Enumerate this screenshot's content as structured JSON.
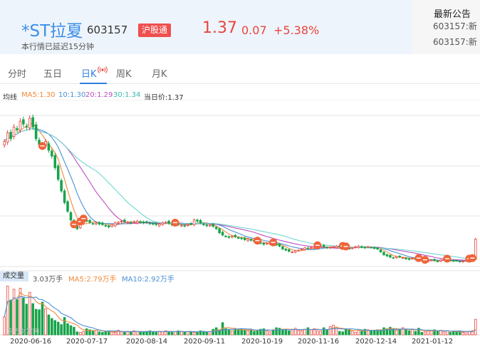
{
  "header": {
    "stock_name": "*ST拉夏",
    "stock_code": "603157",
    "badge": "沪股通",
    "price": "1.37",
    "change": "0.07",
    "change_pct": "+5.38%",
    "delay_note": "本行情已延迟15分钟"
  },
  "news": {
    "title": "最新公告",
    "items": [
      "603157:新",
      "603157:新"
    ]
  },
  "tabs": [
    {
      "label": "分时"
    },
    {
      "label": "五日"
    },
    {
      "label": "日K"
    },
    {
      "label": "周K"
    },
    {
      "label": "月K"
    }
  ],
  "legend": {
    "label": "均线",
    "ma5": "MA5:1.30",
    "ma10": "10:1.30",
    "ma20": "20:1.29",
    "ma30": "30:1.34",
    "current": "当日价:1.37"
  },
  "volume": {
    "title": "成交量",
    "value": "3.03万手",
    "ma5": "MA5:2.79万手",
    "ma10": "MA10:2.92万手"
  },
  "watermark": "东方财富网",
  "chart_data": {
    "type": "candlestick",
    "x_ticks": [
      "2020-06-16",
      "2020-07-17",
      "2020-08-14",
      "2020-09-11",
      "2020-10-19",
      "2020-11-16",
      "2020-12-14",
      "2021-01-12"
    ],
    "grid": true,
    "colors": {
      "up": "#e8453c",
      "down": "#19a34a",
      "ma5": "#f08a3c",
      "ma10": "#4a90d6",
      "ma20": "#c04fc0",
      "ma30": "#6fd6d0",
      "marker": "#f0643a"
    },
    "close": [
      3.05,
      3.2,
      3.1,
      3.3,
      3.25,
      3.4,
      3.35,
      3.3,
      3.45,
      3.3,
      3.1,
      3.0,
      2.95,
      3.05,
      2.9,
      2.8,
      2.6,
      2.4,
      2.2,
      2.0,
      1.85,
      1.7,
      1.6,
      1.55,
      1.65,
      1.7,
      1.68,
      1.66,
      1.64,
      1.65,
      1.63,
      1.62,
      1.6,
      1.58,
      1.62,
      1.65,
      1.66,
      1.68,
      1.67,
      1.66,
      1.65,
      1.67,
      1.68,
      1.66,
      1.65,
      1.66,
      1.64,
      1.63,
      1.62,
      1.63,
      1.65,
      1.66,
      1.64,
      1.62,
      1.63,
      1.62,
      1.61,
      1.6,
      1.62,
      1.63,
      1.7,
      1.68,
      1.65,
      1.62,
      1.6,
      1.61,
      1.59,
      1.55,
      1.48,
      1.44,
      1.42,
      1.4,
      1.42,
      1.41,
      1.39,
      1.38,
      1.36,
      1.37,
      1.35,
      1.33,
      1.32,
      1.3,
      1.28,
      1.3,
      1.31,
      1.29,
      1.27,
      1.25,
      1.2,
      1.18,
      1.16,
      1.15,
      1.17,
      1.18,
      1.2,
      1.22,
      1.21,
      1.23,
      1.22,
      1.24,
      1.25,
      1.24,
      1.22,
      1.23,
      1.24,
      1.25,
      1.24,
      1.23,
      1.22,
      1.21,
      1.22,
      1.24,
      1.25,
      1.23,
      1.22,
      1.24,
      1.23,
      1.21,
      1.2,
      1.15,
      1.1,
      1.08,
      1.06,
      1.05,
      1.07,
      1.06,
      1.05,
      1.03,
      1.02,
      1.04,
      1.03,
      1.02,
      1.0,
      0.99,
      1.0,
      1.01,
      1.0,
      0.99,
      1.01,
      1.02,
      1.01,
      1.0,
      0.99,
      1.0,
      0.98,
      0.99,
      1.0,
      1.01,
      1.02,
      1.37
    ],
    "volume": [
      3.5,
      9.5,
      6.8,
      8.9,
      6.9,
      9.1,
      7.2,
      6.0,
      8.3,
      6.1,
      5.0,
      4.9,
      6.4,
      5.1,
      3.9,
      3.2,
      2.8,
      2.5,
      2.0,
      3.4,
      2.2,
      1.8,
      1.5,
      0.6,
      0.5,
      0.7,
      1.2,
      1.0,
      0.8,
      0.9,
      0.6,
      0.5,
      0.7,
      0.8,
      0.6,
      0.5,
      0.9,
      0.6,
      0.5,
      0.7,
      0.6,
      0.8,
      0.7,
      0.5,
      0.6,
      0.7,
      0.8,
      0.6,
      0.5,
      0.7,
      0.6,
      0.8,
      0.7,
      0.5,
      0.6,
      0.8,
      0.7,
      0.5,
      0.6,
      0.7,
      0.5,
      0.6,
      0.8,
      0.7,
      0.5,
      0.6,
      1.1,
      1.4,
      1.0,
      2.4,
      1.2,
      1.0,
      0.8,
      1.1,
      1.0,
      1.2,
      0.9,
      0.8,
      1.0,
      0.7,
      0.9,
      1.1,
      1.2,
      0.8,
      0.6,
      1.0,
      1.4,
      1.3,
      1.1,
      0.9,
      0.8,
      1.1,
      1.3,
      0.9,
      0.8,
      1.1,
      1.4,
      1.0,
      1.2,
      0.8,
      0.8,
      1.4,
      1.0,
      1.6,
      1.9,
      1.5,
      0.7,
      0.6,
      1.2,
      1.1,
      0.8,
      0.5,
      0.9,
      0.7,
      1.1,
      1.0,
      0.8,
      0.9,
      1.0,
      1.0,
      1.4,
      1.2,
      1.5,
      1.1,
      0.9,
      1.0,
      1.4,
      1.0,
      0.8,
      1.1,
      0.7,
      1.3,
      0.5,
      0.6,
      0.8,
      0.9,
      1.0,
      0.7,
      0.9,
      0.6,
      0.8,
      0.5,
      0.7,
      0.6,
      0.8,
      0.5,
      0.6,
      0.7,
      0.8,
      3.03
    ]
  }
}
